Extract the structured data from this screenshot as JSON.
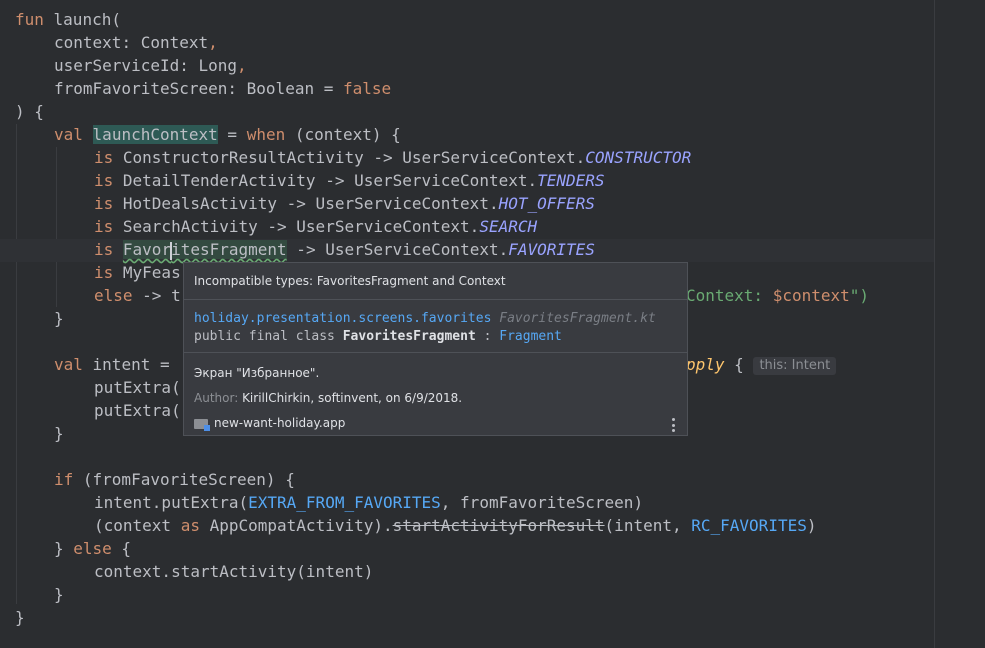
{
  "code": {
    "l1": {
      "kw": "fun",
      "rest": " launch("
    },
    "l2": {
      "name": "context",
      "type": ": Context",
      "comma": ","
    },
    "l3": {
      "name": "userServiceId",
      "type": ": Long",
      "comma": ","
    },
    "l4": {
      "name": "fromFavoriteScreen",
      "type": ": Boolean = ",
      "val": "false"
    },
    "l5": {
      "text": ") {"
    },
    "l6": {
      "kw": "val",
      "var": "launchContext",
      "eq": " = ",
      "when": "when",
      "rest": " (context) {"
    },
    "l7": {
      "is": "is",
      "cls": " ConstructorResultActivity -> UserServiceContext.",
      "const": "CONSTRUCTOR"
    },
    "l8": {
      "is": "is",
      "cls": " DetailTenderActivity -> UserServiceContext.",
      "const": "TENDERS"
    },
    "l9": {
      "is": "is",
      "cls": " HotDealsActivity -> UserServiceContext.",
      "const": "HOT_OFFERS"
    },
    "l10": {
      "is": "is",
      "cls": " SearchActivity -> UserServiceContext.",
      "const": "SEARCH"
    },
    "l11": {
      "is": "is",
      "pre": "Favor",
      "post": "itesFragment",
      "cls": " -> UserServiceContext.",
      "const": "FAVORITES"
    },
    "l12": {
      "is": "is",
      "cls": " MyFeas"
    },
    "l13": {
      "else": "else",
      "arrow": " -> t",
      "tail_str": "Context: ",
      "tail_tmpl": "$context",
      "tail_end": "\")"
    },
    "l14": {
      "text": "}"
    },
    "l16": {
      "kw": "val",
      "rest": " intent = ",
      "apply": "pply",
      "brace": " {",
      "hint": "this: Intent"
    },
    "l17": {
      "text": "putExtra("
    },
    "l18": {
      "text": "putExtra("
    },
    "l19": {
      "text": "}"
    },
    "l21": {
      "kw": "if",
      "rest": " (fromFavoriteScreen) {"
    },
    "l22": {
      "a": "intent.putExtra(",
      "c": "EXTRA_FROM_FAVORITES",
      "b": ", fromFavoriteScreen)"
    },
    "l23": {
      "a": "(context ",
      "as": "as",
      "b": " AppCompatActivity).",
      "strike": "startActivityForResult",
      "c": "(intent, ",
      "d": "RC_FAVORITES",
      "e": ")"
    },
    "l24": {
      "a": "} ",
      "else": "else",
      "b": " {"
    },
    "l25": {
      "text": "context.startActivity(intent)"
    },
    "l26": {
      "text": "}"
    },
    "l27": {
      "text": "}"
    }
  },
  "popup": {
    "header": "Incompatible types: FavoritesFragment and Context",
    "package": "holiday.presentation.screens.favorites",
    "file": "FavoritesFragment.kt",
    "decl_prefix": "public final class ",
    "decl_class": "FavoritesFragment",
    "decl_colon": " : ",
    "decl_super": "Fragment",
    "doc": "Экран \"Избранное\".",
    "author_label": "Author:",
    "author_value": "KirillChirkin, softinvent, on 6/9/2018.",
    "module": "new-want-holiday.app"
  }
}
